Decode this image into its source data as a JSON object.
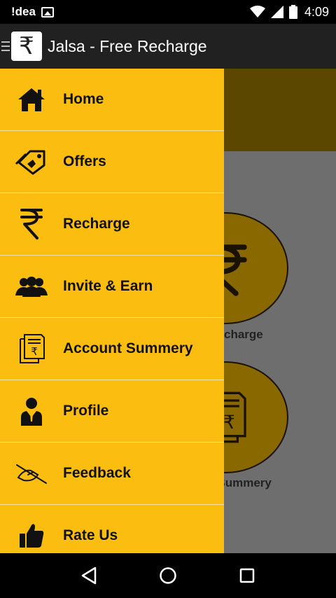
{
  "status_bar": {
    "carrier": "!dea",
    "time": "4:09"
  },
  "app_bar": {
    "title": "Jalsa - Free Recharge",
    "logo_glyph": "₹"
  },
  "background": {
    "labels": [
      "charge",
      "t Summery"
    ],
    "glyph": "₹"
  },
  "drawer": {
    "items": [
      {
        "label": "Home",
        "icon": "home-icon"
      },
      {
        "label": "Offers",
        "icon": "tag-icon"
      },
      {
        "label": "Recharge",
        "icon": "rupee-icon"
      },
      {
        "label": "Invite & Earn",
        "icon": "users-icon"
      },
      {
        "label": "Account Summery",
        "icon": "receipt-icon"
      },
      {
        "label": "Profile",
        "icon": "profile-icon"
      },
      {
        "label": "Feedback",
        "icon": "feedback-icon"
      },
      {
        "label": "Rate Us",
        "icon": "thumbs-up-icon"
      }
    ]
  }
}
